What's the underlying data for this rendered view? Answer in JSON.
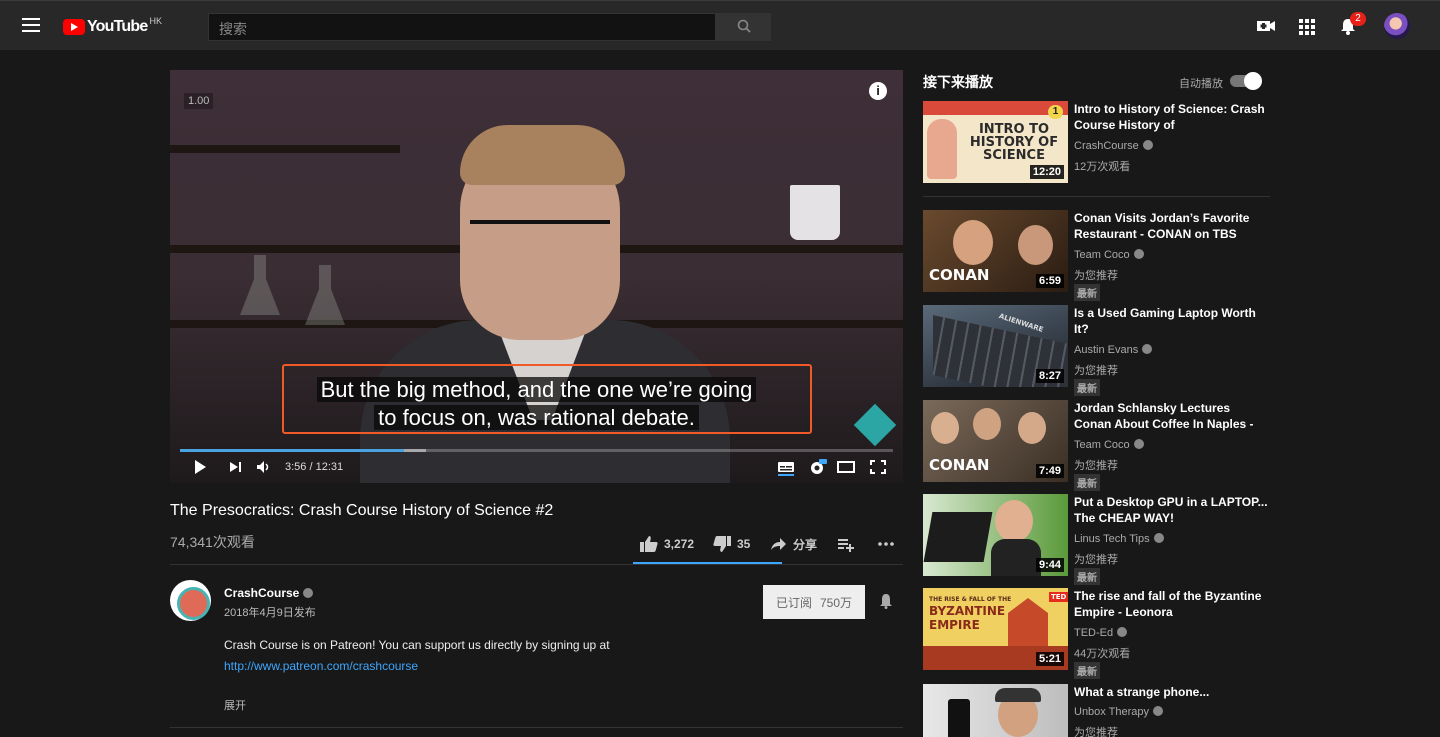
{
  "topbar": {
    "logo_text": "YouTube",
    "region": "HK",
    "search_placeholder": "搜索",
    "notification_count": "2"
  },
  "player": {
    "speed": "1.00",
    "caption_line1": "But the big method, and the one we’re going",
    "caption_line2": "to focus on, was rational debate.",
    "time": "3:56 / 12:31",
    "progress_played": 0.314,
    "progress_loaded": 0.345
  },
  "video": {
    "title": "The Presocratics: Crash Course History of Science #2",
    "views": "74,341次观看",
    "likes": "3,272",
    "dislikes": "35",
    "share_label": "分享"
  },
  "channel": {
    "name": "CrashCourse",
    "published": "2018年4月9日发布",
    "subscribe_label": "已订阅",
    "subscriber_count": "750万",
    "description": "Crash Course is on Patreon! You can support us directly by signing up at",
    "link": "http://www.patreon.com/crashcourse",
    "show_more": "展开"
  },
  "sidebar": {
    "up_next": "接下来播放",
    "autoplay": "自动播放",
    "items": [
      {
        "title": "Intro to History of Science: Crash Course History of",
        "channel": "CrashCourse",
        "meta": "12万次观看",
        "duration": "12:20",
        "new": ""
      },
      {
        "title": "Conan Visits Jordan’s Favorite Restaurant - CONAN on TBS",
        "channel": "Team Coco",
        "meta": "为您推荐",
        "duration": "6:59",
        "new": "最新"
      },
      {
        "title": "Is a Used Gaming Laptop Worth It?",
        "channel": "Austin Evans",
        "meta": "为您推荐",
        "duration": "8:27",
        "new": "最新"
      },
      {
        "title": "Jordan Schlansky Lectures Conan About Coffee In Naples -",
        "channel": "Team Coco",
        "meta": "为您推荐",
        "duration": "7:49",
        "new": "最新"
      },
      {
        "title": "Put a Desktop GPU in a LAPTOP... The CHEAP WAY!",
        "channel": "Linus Tech Tips",
        "meta": "为您推荐",
        "duration": "9:44",
        "new": "最新"
      },
      {
        "title": "The rise and fall of the Byzantine Empire - Leonora",
        "channel": "TED-Ed",
        "meta": "44万次观看",
        "duration": "5:21",
        "new": "最新"
      },
      {
        "title": "What a strange phone...",
        "channel": "Unbox Therapy",
        "meta": "为您推荐",
        "duration": "",
        "new": ""
      }
    ]
  },
  "thumb_text": {
    "intro": "INTRO TO HISTORY OF SCIENCE",
    "conan": "CONAN",
    "byzantine": "BYZANTINE EMPIRE",
    "byzantine_small": "THE RISE & FALL OF THE",
    "alienware": "ALIENWARE",
    "ted": "TED",
    "playlist_index": "1"
  },
  "colors": {
    "accent": "#3ea6ff",
    "brand": "#ff0000",
    "caption_border": "#f05a28"
  }
}
